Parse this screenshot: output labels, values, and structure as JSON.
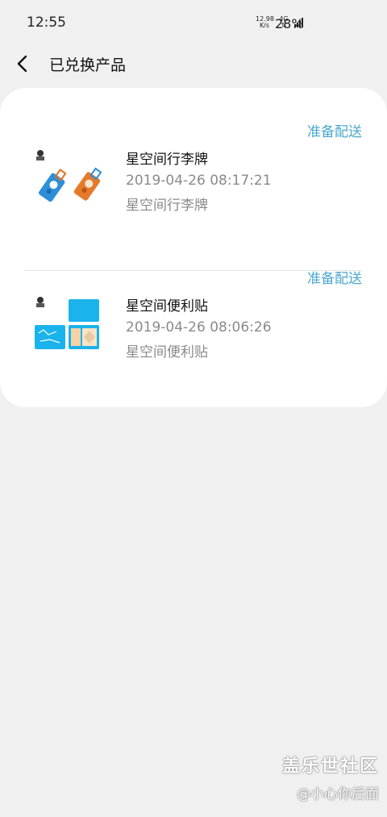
{
  "status_bar": {
    "time": "12:55",
    "net_speed_value": "12.98",
    "net_speed_unit": "K/s",
    "network_type": "4G",
    "battery": "28%"
  },
  "header": {
    "title": "已兑换产品"
  },
  "items": [
    {
      "status": "准备配送",
      "name": "星空间行李牌",
      "date": "2019-04-26 08:17:21",
      "description": "星空间行李牌",
      "thumbnail_icon": "luggage-tag-icon"
    },
    {
      "status": "准备配送",
      "name": "星空间便利贴",
      "date": "2019-04-26 08:06:26",
      "description": "星空间便利贴",
      "thumbnail_icon": "sticky-notes-icon"
    }
  ],
  "watermark": {
    "line1": "盖乐世社区",
    "line2": "@小心你后面"
  },
  "colors": {
    "accent": "#4aa8cf",
    "background": "#f0f0f0",
    "card": "#ffffff",
    "secondary_text": "#8a8a8a"
  }
}
